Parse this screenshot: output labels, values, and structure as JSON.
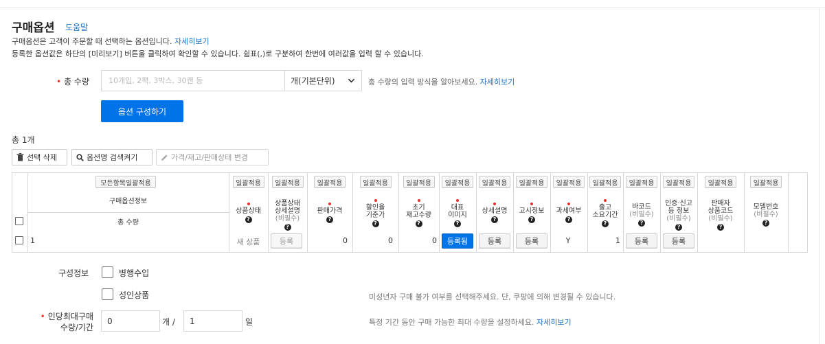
{
  "header": {
    "title": "구매옵션",
    "help_link": "도움말",
    "desc_line1": "구매옵션은 고객이 주문할 때 선택하는 옵션입니다.",
    "desc_line1_link": "자세히보기",
    "desc_line2": "등록한 옵션값은 하단의 [미리보기] 버튼을 클릭하여 확인할 수 있습니다. 쉼표(,)로 구분하여 한번에 여러값을 입력 할 수 있습니다."
  },
  "total_qty": {
    "label": "총 수량",
    "placeholder": "10개입, 2팩, 3박스, 30캔 등",
    "value": "",
    "unit_selected": "개(기본단위)",
    "hint": "총 수량의 입력 방식을 알아보세요.",
    "hint_link": "자세히보기"
  },
  "compose_button": "옵션 구성하기",
  "count_label": "총 1개",
  "toolbar": {
    "delete": "선택 삭제",
    "search": "옵션명 검색켜기",
    "edit": "가격/재고/판매상태 변경"
  },
  "table": {
    "apply_all": "모든항목일괄적용",
    "apply_one": "일괄적용",
    "group_header": "구매옵션정보",
    "qty_header": "총 수량",
    "columns": [
      {
        "lines": [
          "상품상태"
        ],
        "sub": [],
        "required": true
      },
      {
        "lines": [
          "상품상태",
          "상세설명"
        ],
        "sub": [
          "(비필수)"
        ],
        "required": false
      },
      {
        "lines": [
          "판매가격"
        ],
        "sub": [],
        "required": true
      },
      {
        "lines": [
          "할인율",
          "기준가"
        ],
        "sub": [],
        "required": true
      },
      {
        "lines": [
          "초기",
          "재고수량"
        ],
        "sub": [],
        "required": true
      },
      {
        "lines": [
          "대표",
          "이미지"
        ],
        "sub": [],
        "required": true
      },
      {
        "lines": [
          "상세설명"
        ],
        "sub": [],
        "required": true
      },
      {
        "lines": [
          "고시정보"
        ],
        "sub": [],
        "required": true
      },
      {
        "lines": [
          "과세여부"
        ],
        "sub": [],
        "required": true
      },
      {
        "lines": [
          "출고",
          "소요기간"
        ],
        "sub": [],
        "required": true
      },
      {
        "lines": [
          "바코드"
        ],
        "sub": [
          "(비필수)"
        ],
        "required": false
      },
      {
        "lines": [
          "인증·신고",
          "등 정보"
        ],
        "sub": [
          "(비필수)"
        ],
        "required": false
      },
      {
        "lines": [
          "판매자",
          "상품코드"
        ],
        "sub": [
          "(비필수)"
        ],
        "required": false
      },
      {
        "lines": [
          "모델번호"
        ],
        "sub": [
          "(비필수)"
        ],
        "required": false
      }
    ],
    "row": {
      "qty": "1",
      "status": "새 상품",
      "status_desc_btn": "등록",
      "price": "0",
      "discount_base": "0",
      "stock": "0",
      "image_btn": "등록됨",
      "detail_btn": "등록",
      "notice_btn": "등록",
      "tax": "Y",
      "lead_time": "1",
      "barcode_btn": "등록",
      "cert_btn": "등록"
    }
  },
  "compose_info": {
    "label": "구성정보",
    "parallel_import": "병행수입",
    "adult": "성인상품",
    "adult_hint": "미성년자 구매 불가 여부를 선택해주세요. 단, 쿠팡에 의해 변경될 수 있습니다."
  },
  "max_purchase": {
    "label_line1": "인당최대구매",
    "label_line2": "수량/기간",
    "qty_value": "0",
    "qty_unit": "개 /",
    "days_value": "1",
    "days_unit": "일",
    "hint": "특정 기간 동안 구매 가능한 최대 수량을 설정하세요.",
    "hint_link": "자세히보기"
  },
  "colors": {
    "primary": "#0073e9",
    "link": "#1a73c8",
    "required": "#e5322d"
  }
}
